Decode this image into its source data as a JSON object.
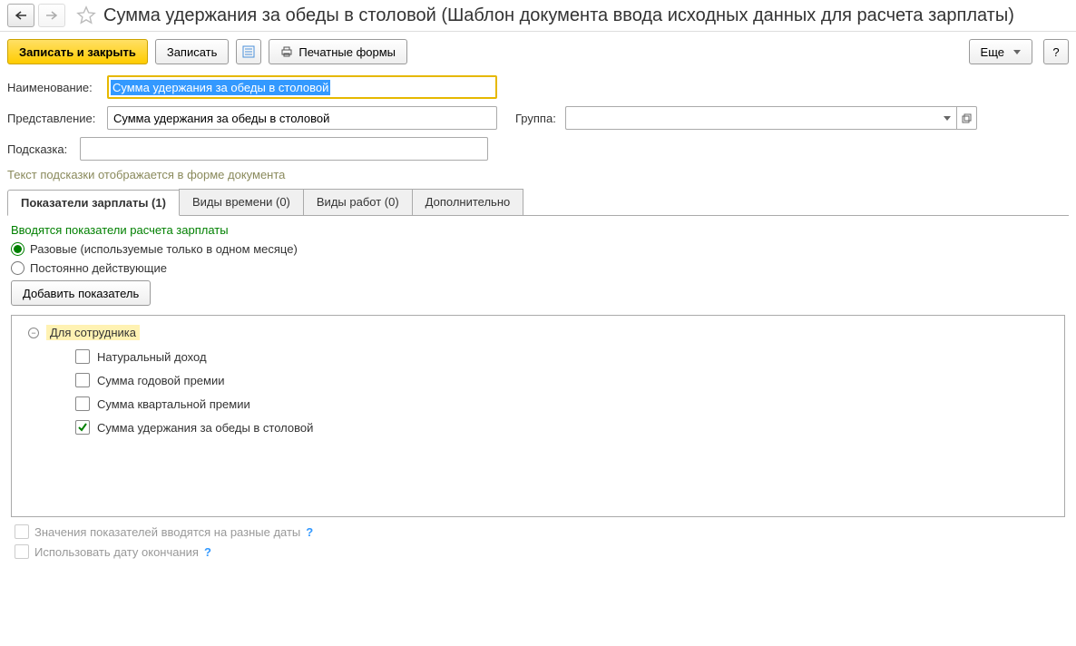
{
  "header": {
    "title": "Сумма удержания за обеды в столовой (Шаблон документа ввода исходных данных для расчета зарплаты)"
  },
  "toolbar": {
    "save_close": "Записать и закрыть",
    "save": "Записать",
    "print_forms": "Печатные формы",
    "more": "Еще",
    "help": "?"
  },
  "form": {
    "name_label": "Наименование:",
    "name_value": "Сумма удержания за обеды в столовой",
    "repr_label": "Представление:",
    "repr_value": "Сумма удержания за обеды в столовой",
    "group_label": "Группа:",
    "group_value": "",
    "hint_label": "Подсказка:",
    "hint_value": "",
    "hint_text": "Текст подсказки отображается в форме документа"
  },
  "tabs": [
    {
      "label": "Показатели зарплаты (1)",
      "active": true
    },
    {
      "label": "Виды времени (0)",
      "active": false
    },
    {
      "label": "Виды работ (0)",
      "active": false
    },
    {
      "label": "Дополнительно",
      "active": false
    }
  ],
  "section": {
    "title": "Вводятся показатели расчета зарплаты",
    "radio1": "Разовые (используемые только в одном месяце)",
    "radio2": "Постоянно действующие",
    "add_btn": "Добавить показатель"
  },
  "tree": {
    "group_label": "Для сотрудника",
    "items": [
      {
        "label": "Натуральный доход",
        "checked": false
      },
      {
        "label": "Сумма годовой премии",
        "checked": false
      },
      {
        "label": "Сумма квартальной премии",
        "checked": false
      },
      {
        "label": "Сумма удержания за обеды в столовой",
        "checked": true
      }
    ]
  },
  "bottom": {
    "dates_diff": "Значения показателей вводятся на разные даты",
    "use_end_date": "Использовать дату окончания"
  }
}
